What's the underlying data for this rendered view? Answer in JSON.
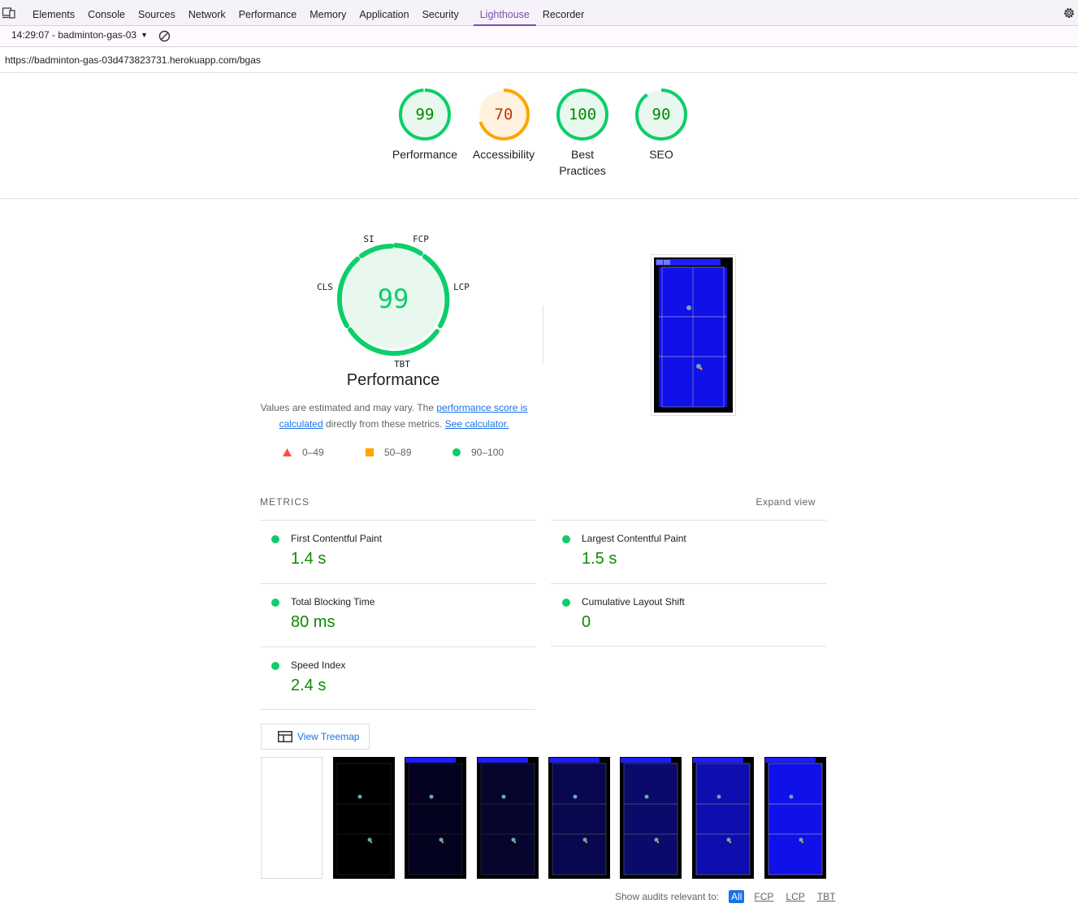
{
  "devtools": {
    "tabs": [
      {
        "label": "Elements"
      },
      {
        "label": "Console"
      },
      {
        "label": "Sources"
      },
      {
        "label": "Network"
      },
      {
        "label": "Performance"
      },
      {
        "label": "Memory"
      },
      {
        "label": "Application"
      },
      {
        "label": "Security"
      },
      {
        "label": "Lighthouse",
        "active": true
      },
      {
        "label": "Recorder"
      }
    ],
    "report_selector": "14:29:07 - badminton-gas-03",
    "accent_color": "#7c4dab"
  },
  "report": {
    "url": "https://badminton-gas-03d473823731.herokuapp.com/bgas",
    "categories": [
      {
        "score": "99",
        "label": "Performance",
        "level": "pass",
        "value": 0.99
      },
      {
        "score": "70",
        "label": "Accessibility",
        "level": "average",
        "value": 0.7
      },
      {
        "score": "100",
        "label": "Best Practices",
        "level": "pass",
        "value": 1.0
      },
      {
        "score": "90",
        "label": "SEO",
        "level": "pass",
        "value": 0.9
      }
    ],
    "colors": {
      "pass": "#0cce6b",
      "average": "#ffa400",
      "fail": "#ff4e42",
      "pass_text": "#008800",
      "average_text": "#c33300"
    },
    "performance": {
      "score": "99",
      "title": "Performance",
      "gauge_labels": {
        "si": "SI",
        "fcp": "FCP",
        "lcp": "LCP",
        "tbt": "TBT",
        "cls": "CLS"
      },
      "desc_prefix": "Values are estimated and may vary. The ",
      "desc_link1": "performance score is calculated",
      "desc_middle": " directly from these metrics. ",
      "desc_link2": "See calculator.",
      "legend": {
        "fail": "0–49",
        "average": "50–89",
        "pass": "90–100"
      }
    },
    "metrics": {
      "heading": "METRICS",
      "expand": "Expand view",
      "items": [
        {
          "name": "First Contentful Paint",
          "value": "1.4 s"
        },
        {
          "name": "Largest Contentful Paint",
          "value": "1.5 s"
        },
        {
          "name": "Total Blocking Time",
          "value": "80 ms"
        },
        {
          "name": "Cumulative Layout Shift",
          "value": "0"
        },
        {
          "name": "Speed Index",
          "value": "2.4 s"
        }
      ]
    },
    "treemap_button": "View Treemap",
    "filter": {
      "label": "Show audits relevant to:",
      "chips": [
        "All",
        "FCP",
        "LCP",
        "TBT"
      ]
    }
  }
}
